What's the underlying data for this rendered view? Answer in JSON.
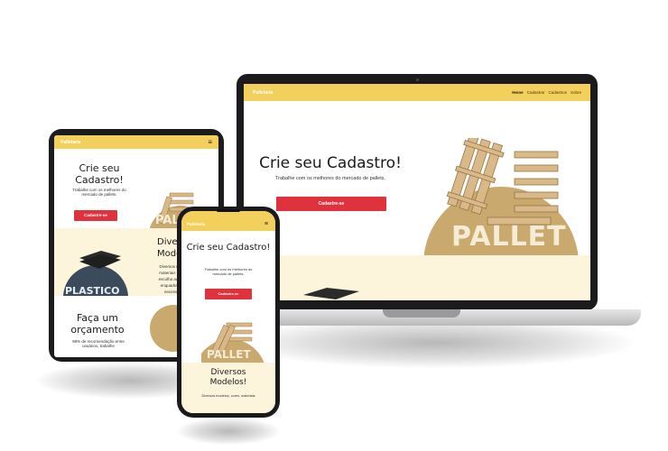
{
  "colors": {
    "nav": "#f3cf5c",
    "button": "#e0323d",
    "cream": "#fdf4dc",
    "circle": "#c9a96e",
    "device": "#1b1b1d"
  },
  "laptop": {
    "brand": "Palletaria",
    "links": [
      "Home",
      "Cadastrar",
      "Cadastros",
      "Sobre"
    ],
    "title": "Crie seu Cadastro!",
    "subtitle": "Trabalhe com os melhores do mercado de pallets.",
    "button": "Cadastre-se",
    "badge": "PALLET"
  },
  "tablet": {
    "brand": "Palletaria",
    "menu_icon": "≡",
    "title": "Crie seu Cadastro!",
    "subtitle": "Trabalhe com os melhores do mercado de pallets.",
    "button": "Cadastre-se",
    "badge": "PAL",
    "section2_title": "Divers Modelo",
    "section2_text": "Diversos mo materiais e c escolha aque enquadra c necess",
    "badge2": "PLASTICO",
    "section3_title": "Faça um orçamento",
    "section3_text": "98% de recomendação entre usuários, trabalhe"
  },
  "phone": {
    "brand": "Palletaria",
    "menu_icon": "≡",
    "title": "Crie seu Cadastro!",
    "subtitle": "Trabalhe com os melhores do mercado de pallets.",
    "button": "Cadastre-se",
    "badge": "PALLET",
    "section2_title": "Diversos Modelos!",
    "section2_text": "Diversos modelos, cores, materiais"
  }
}
